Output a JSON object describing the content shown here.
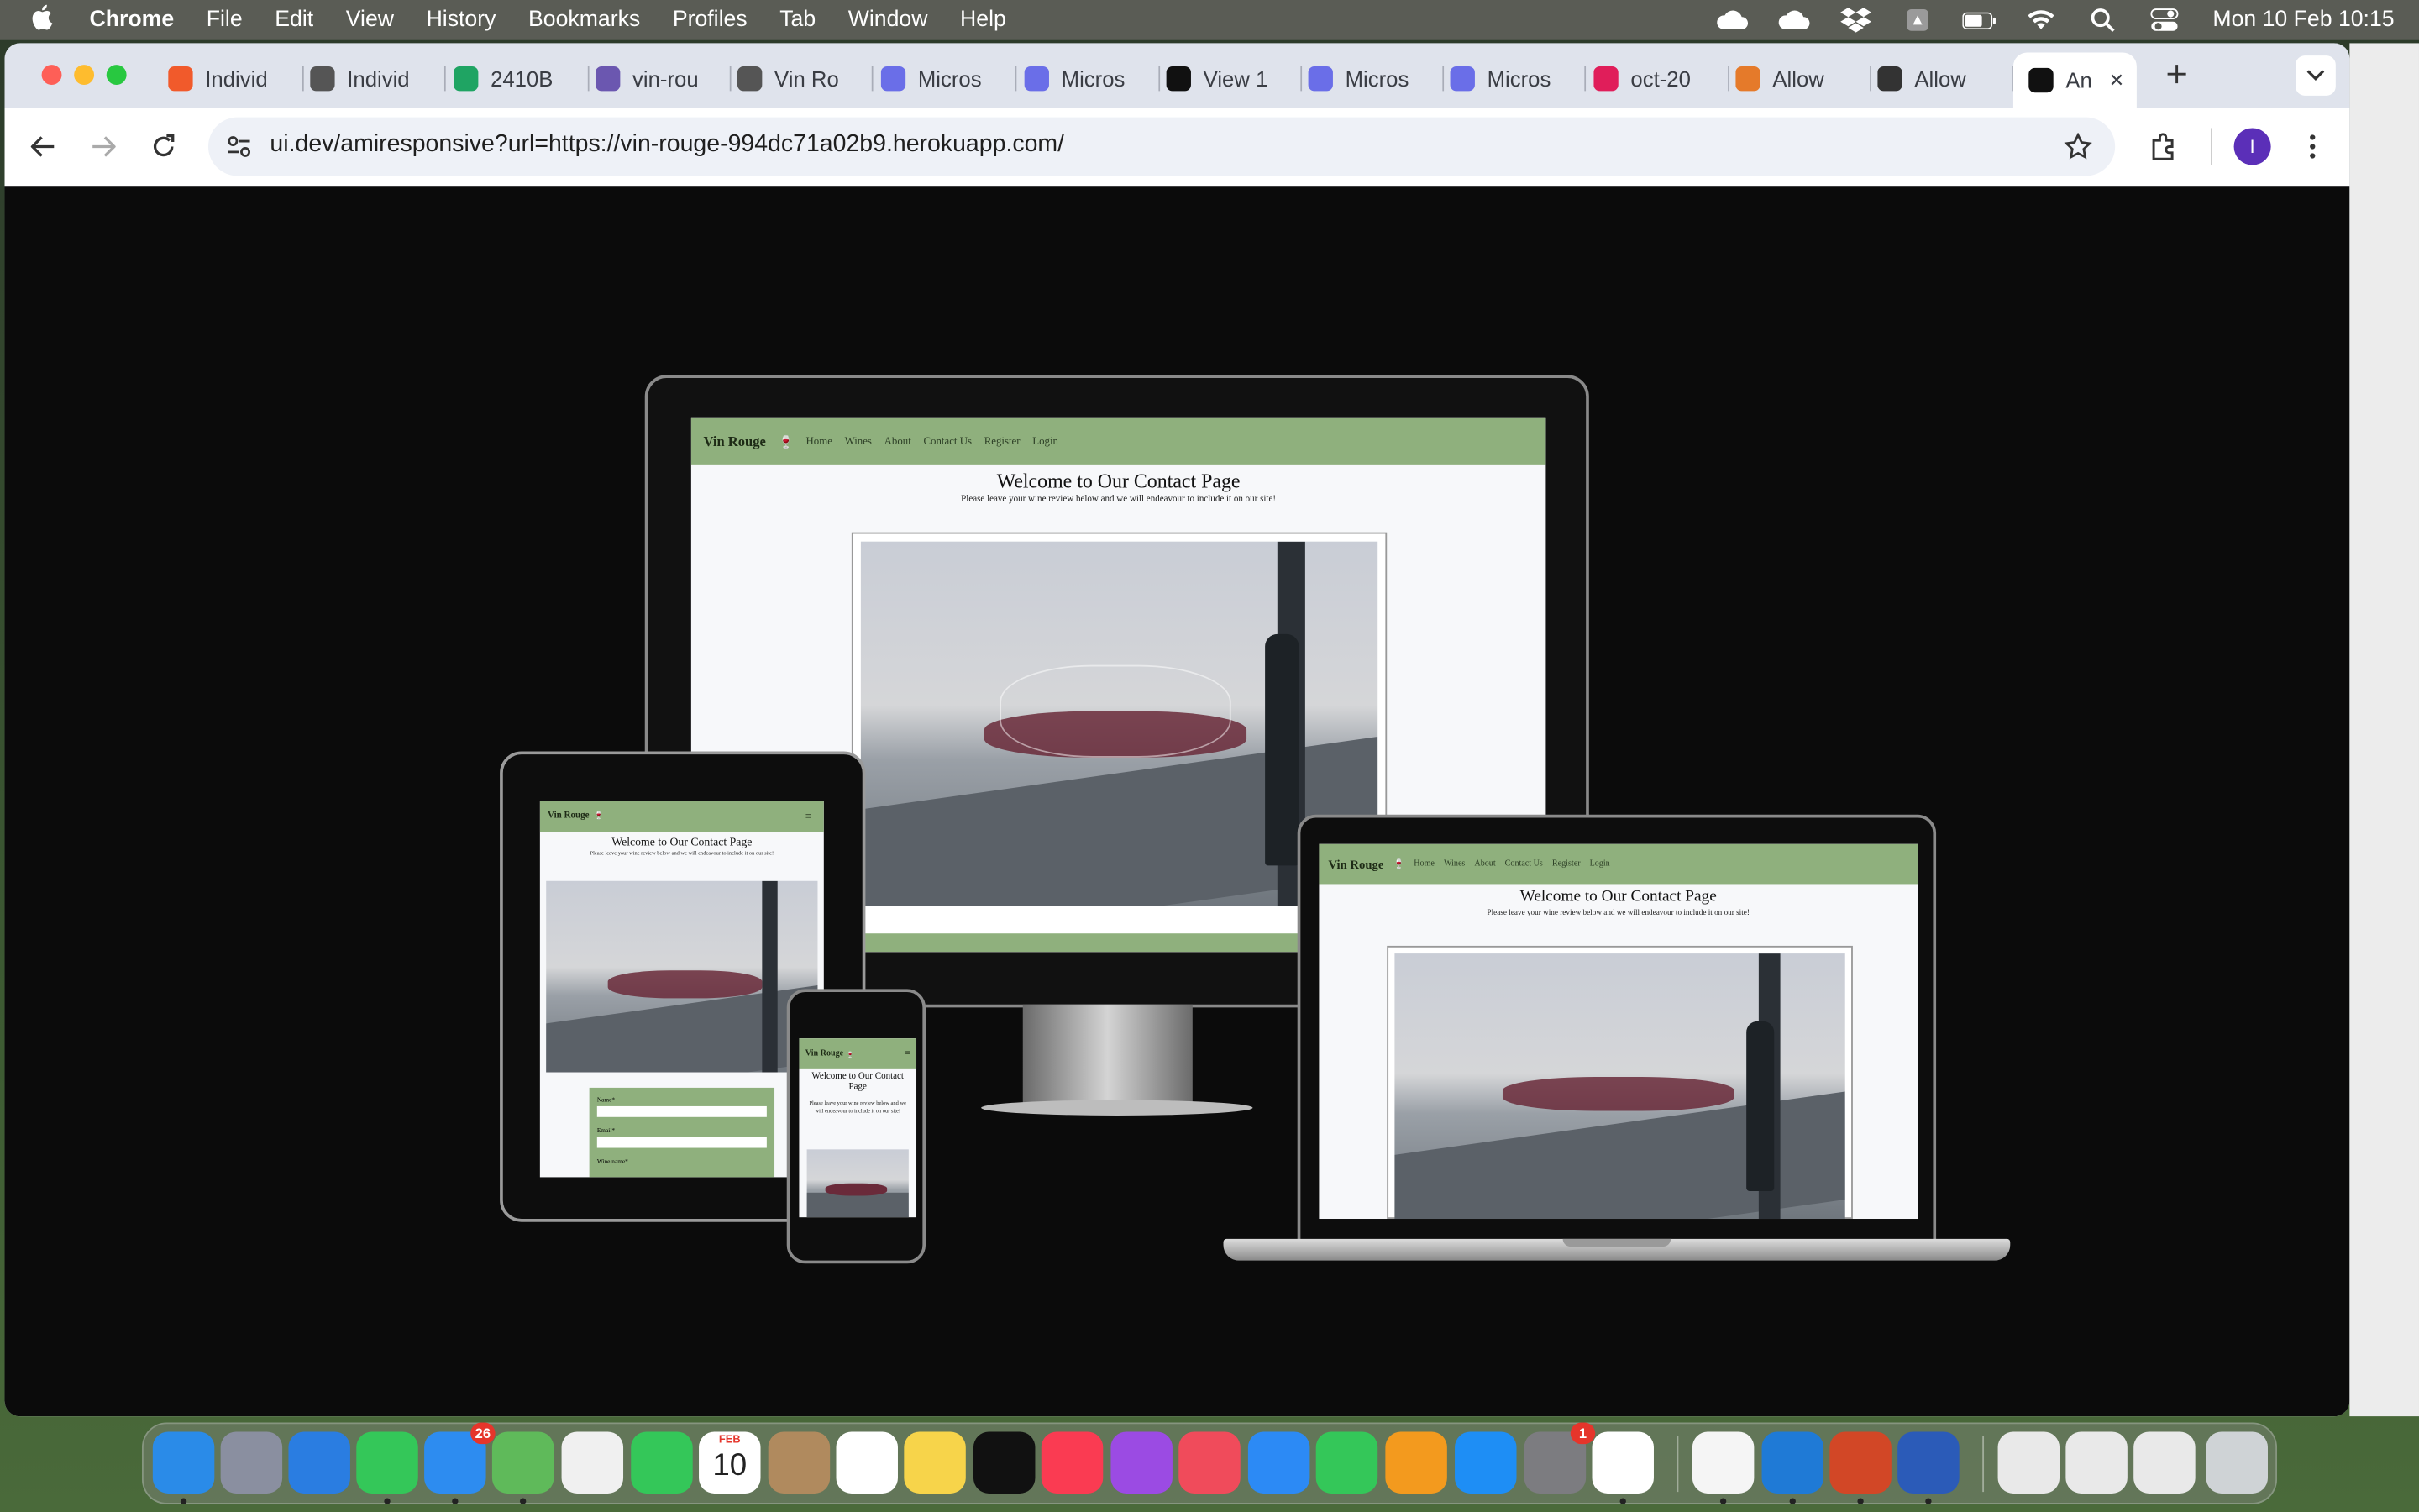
{
  "menubar": {
    "app": "Chrome",
    "items": [
      "File",
      "Edit",
      "View",
      "History",
      "Bookmarks",
      "Profiles",
      "Tab",
      "Window",
      "Help"
    ],
    "clock": "Mon 10 Feb  10:15"
  },
  "tabs": [
    {
      "label": "Individ",
      "icon": "circle-icon",
      "color": "#f15a2b"
    },
    {
      "label": "Individ",
      "icon": "globe-icon",
      "color": "#555"
    },
    {
      "label": "2410B",
      "icon": "sheets-icon",
      "color": "#1fa463"
    },
    {
      "label": "vin-rou",
      "icon": "heroku-icon",
      "color": "#6b57b0"
    },
    {
      "label": "Vin Ro",
      "icon": "globe-icon",
      "color": "#555"
    },
    {
      "label": "Micros",
      "icon": "copilot-icon",
      "color": "#6a6ee8"
    },
    {
      "label": "Micros",
      "icon": "copilot-icon",
      "color": "#6a6ee8"
    },
    {
      "label": "View 1",
      "icon": "github-icon",
      "color": "#111"
    },
    {
      "label": "Micros",
      "icon": "copilot-icon",
      "color": "#6a6ee8"
    },
    {
      "label": "Micros",
      "icon": "copilot-icon",
      "color": "#6a6ee8"
    },
    {
      "label": "oct-20",
      "icon": "slack-icon",
      "color": "#e01e5a"
    },
    {
      "label": "Allow",
      "icon": "rainbow-icon",
      "color": "#e57a2a"
    },
    {
      "label": "Allow",
      "icon": "window-icon",
      "color": "#333"
    },
    {
      "label": "An",
      "icon": "ui-dev-icon",
      "color": "#111"
    }
  ],
  "address": {
    "url": "ui.dev/amiresponsive?url=https://vin-rouge-994dc71a02b9.herokuapp.com/"
  },
  "profile_initial": "I",
  "site": {
    "brand": "Vin Rouge",
    "brand_emoji": "🍷",
    "nav": [
      "Home",
      "Wines",
      "About",
      "Contact Us",
      "Register",
      "Login"
    ],
    "heading": "Welcome to Our Contact Page",
    "subheading": "Please leave your wine review below and we will endeavour to include it on our site!",
    "form_name": "Name*",
    "form_email": "Email*",
    "form_wine": "Wine name*"
  },
  "dock": {
    "mail_badge": "26",
    "calendar_month": "FEB",
    "calendar_day": "10",
    "settings_badge": "1"
  },
  "colors": {
    "nav_green": "#8fb07d",
    "accent_purple": "#5b2fb8"
  }
}
